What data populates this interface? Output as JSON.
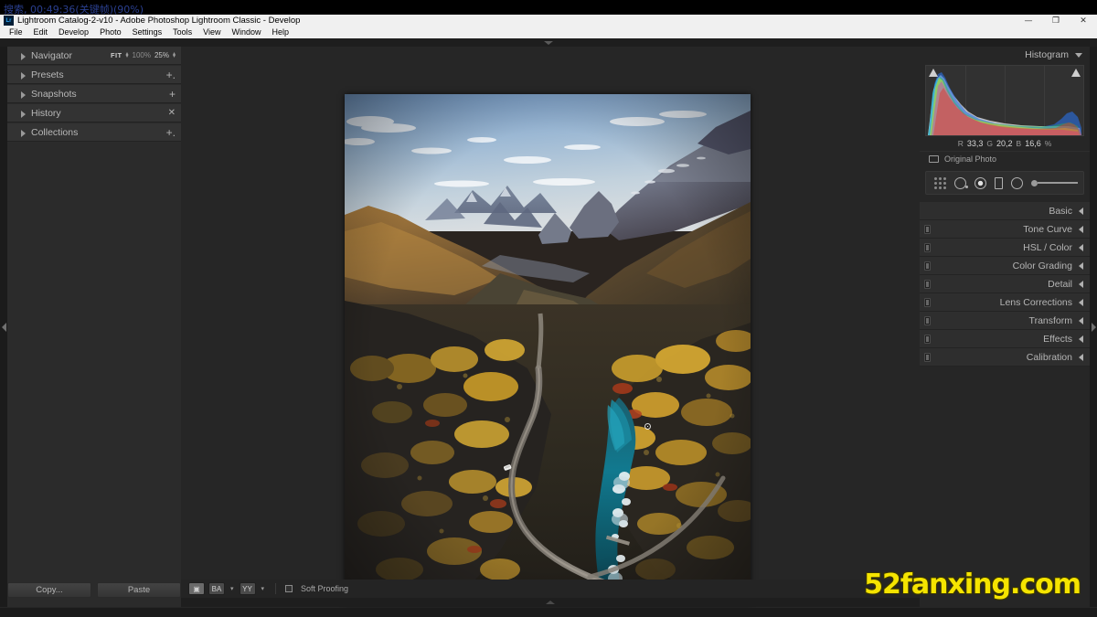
{
  "overlay": {
    "text": "搜索, 00:49:36(关键帧)(90%)"
  },
  "titlebar": {
    "app_icon_text": "Lr",
    "title": "Lightroom Catalog-2-v10 - Adobe Photoshop Lightroom Classic - Develop",
    "minimize": "—",
    "restore": "❐",
    "close": "✕"
  },
  "menubar": {
    "items": [
      "File",
      "Edit",
      "Develop",
      "Photo",
      "Settings",
      "Tools",
      "View",
      "Window",
      "Help"
    ]
  },
  "left_panel": {
    "rows": [
      {
        "label": "Navigator",
        "action": "zoom"
      },
      {
        "label": "Presets",
        "action": "+."
      },
      {
        "label": "Snapshots",
        "action": "+"
      },
      {
        "label": "History",
        "action": "✕"
      },
      {
        "label": "Collections",
        "action": "+."
      }
    ],
    "navigator": {
      "fit": "FIT",
      "zoom_100": "100%",
      "zoom_25": "25%"
    },
    "buttons": {
      "copy": "Copy...",
      "paste": "Paste"
    }
  },
  "toolbar": {
    "view_loupe": "▣",
    "compare_before_after": "BA",
    "compare_yy": "YY",
    "caret": "▾",
    "soft_proofing_label": "Soft Proofing"
  },
  "right_panel": {
    "histogram": {
      "title": "Histogram",
      "r_label": "R",
      "r_value": "33,3",
      "g_label": "G",
      "g_value": "20,2",
      "b_label": "B",
      "b_value": "16,6",
      "unit": "%",
      "original_photo": "Original Photo"
    },
    "tools": [
      "crop-overlay-icon",
      "spot-removal-icon",
      "red-eye-icon",
      "masking-rect-icon",
      "radial-filter-icon",
      "amount-slider-icon"
    ],
    "sections": [
      {
        "label": "Basic",
        "has_switch": false
      },
      {
        "label": "Tone Curve",
        "has_switch": true
      },
      {
        "label": "HSL / Color",
        "has_switch": true,
        "dim_part": "Color"
      },
      {
        "label": "Color Grading",
        "has_switch": true
      },
      {
        "label": "Detail",
        "has_switch": true
      },
      {
        "label": "Lens Corrections",
        "has_switch": true
      },
      {
        "label": "Transform",
        "has_switch": true
      },
      {
        "label": "Effects",
        "has_switch": true
      },
      {
        "label": "Calibration",
        "has_switch": true
      }
    ]
  },
  "watermark": {
    "text": "52fanxing.com",
    "color": "#f5e400"
  },
  "photo": {
    "description": "Aerial autumn landscape of a Norwegian valley with mountains, a winding road, turquoise river with rapids, and a white car"
  },
  "colors": {
    "panel_bg": "#262626",
    "row_bg": "#333333",
    "text": "#b8b8b8",
    "titlebar_bg": "#f0f0f0"
  }
}
